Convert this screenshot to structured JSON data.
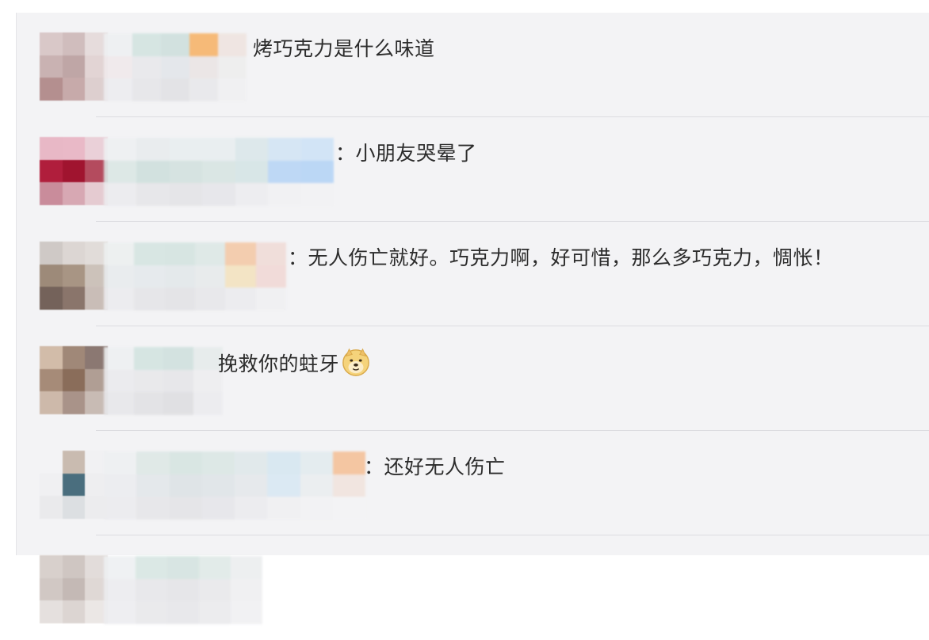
{
  "comments": [
    {
      "text": "烤巧克力是什么味道"
    },
    {
      "text": "：小朋友哭晕了"
    },
    {
      "text": "：无人伤亡就好。巧克力啊，好可惜，那么多巧克力，惆怅！"
    },
    {
      "text": "挽救你的蛀牙",
      "emoji": "doge-face-icon"
    },
    {
      "text": "：还好无人伤亡"
    }
  ],
  "colors": {
    "panel_background": "#f3f3f5",
    "text": "#2c2c2c",
    "divider": "#dcdce0"
  }
}
